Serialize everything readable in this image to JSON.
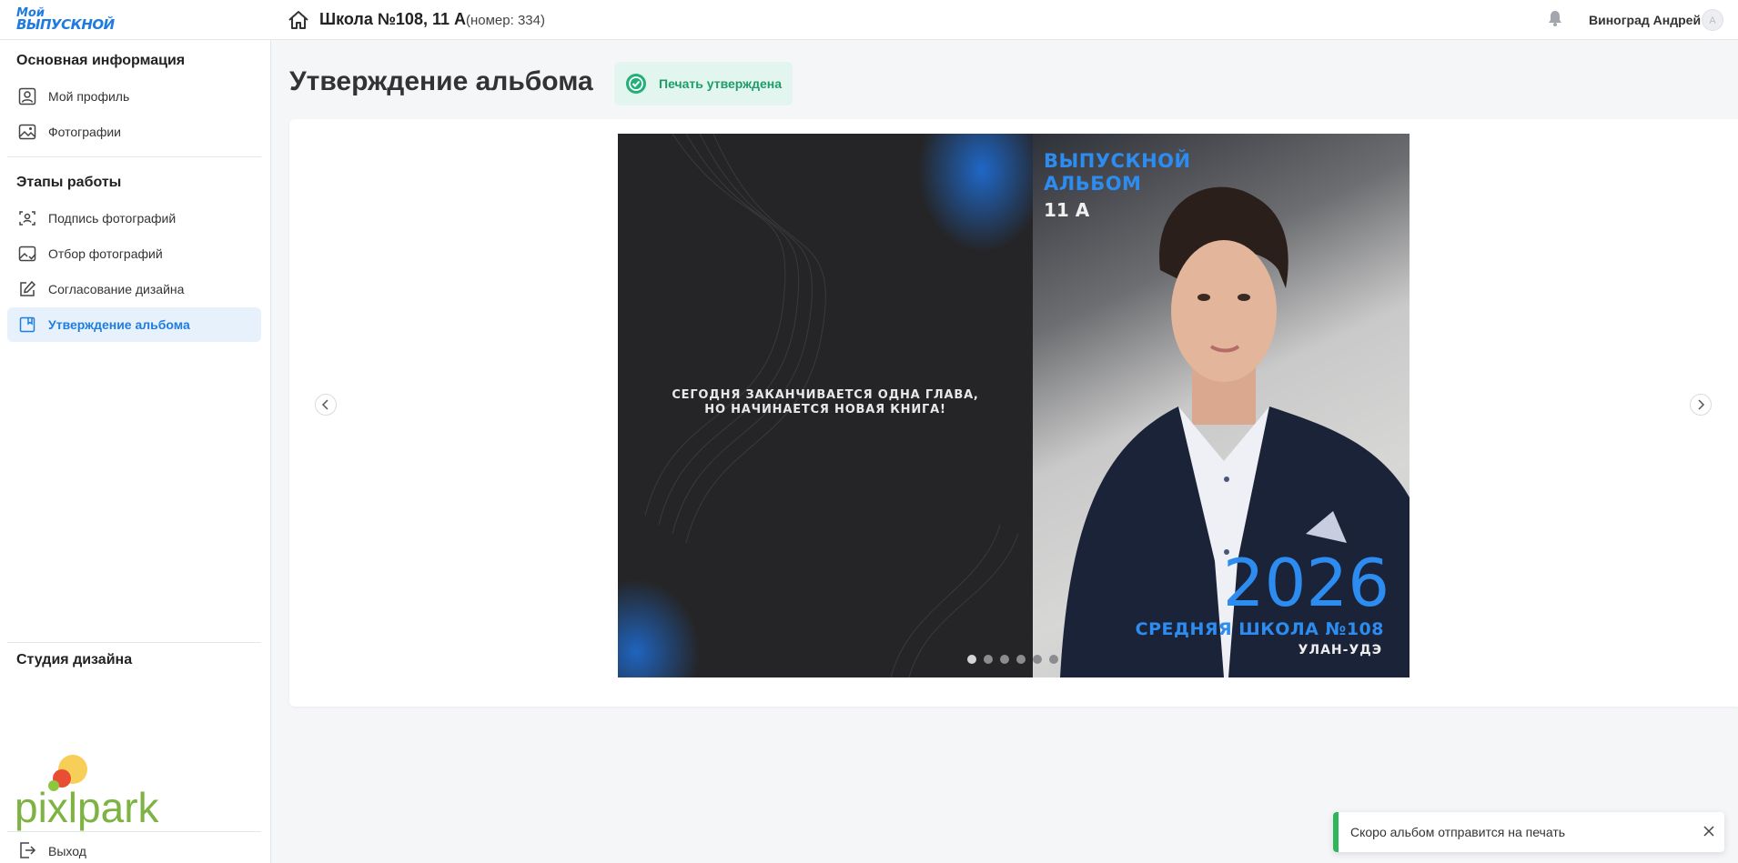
{
  "app": {
    "logo_line1": "Мой",
    "logo_line2": "ВЫПУСКНОЙ"
  },
  "header": {
    "school_title": "Школа №108, 11 А",
    "school_number": "(номер: 334)",
    "user_name": "Виноград Андрей",
    "avatar_initial": "А"
  },
  "sidebar": {
    "section1_title": "Основная информация",
    "section1_items": [
      {
        "label": "Мой профиль",
        "icon": "user-icon"
      },
      {
        "label": "Фотографии",
        "icon": "image-icon"
      }
    ],
    "section2_title": "Этапы работы",
    "section2_items": [
      {
        "label": "Подпись фотографий",
        "icon": "face-scan-icon"
      },
      {
        "label": "Отбор фотографий",
        "icon": "photo-select-icon"
      },
      {
        "label": "Согласование дизайна",
        "icon": "edit-icon"
      },
      {
        "label": "Утверждение альбома",
        "icon": "bookmark-icon",
        "active": true
      }
    ],
    "studio_title": "Студия дизайна",
    "studio_logo_text": "pixlpark",
    "logout_label": "Выход"
  },
  "main": {
    "page_title": "Утверждение альбома",
    "status_badge": "Печать утверждена",
    "album": {
      "quote_line1": "СЕГОДНЯ ЗАКАНЧИВАЕТСЯ ОДНА ГЛАВА,",
      "quote_line2": "НО НАЧИНАЕТСЯ НОВАЯ КНИГА!",
      "title_line1": "ВЫПУСКНОЙ",
      "title_line2": "АЛЬБОМ",
      "class": "11 А",
      "year": "2026",
      "school": "СРЕДНЯЯ ШКОЛА №108",
      "city": "УЛАН-УДЭ"
    },
    "slides_total": 6,
    "slide_current": 1
  },
  "toast": {
    "message": "Скоро альбом отправится на печать"
  },
  "colors": {
    "accent": "#1f7de0",
    "success": "#1e9d6a",
    "toast_bar": "#2fb65a",
    "album_blue": "#2d8cf0"
  }
}
